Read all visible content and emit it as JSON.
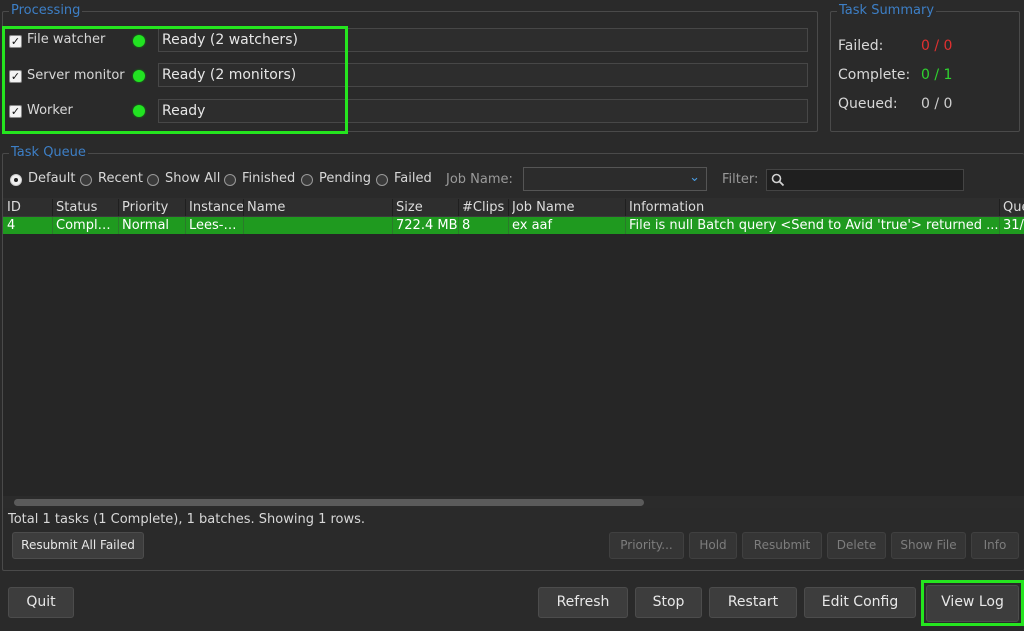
{
  "processing": {
    "legend": "Processing",
    "rows": [
      {
        "label": "File watcher",
        "status": "Ready (2 watchers)",
        "checked": true
      },
      {
        "label": "Server monitor",
        "status": "Ready (2 monitors)",
        "checked": true
      },
      {
        "label": "Worker",
        "status": "Ready",
        "checked": true
      }
    ],
    "indicator_color": "#22e322"
  },
  "summary": {
    "legend": "Task Summary",
    "failed_label": "Failed:",
    "failed_value": "0 / 0",
    "complete_label": "Complete:",
    "complete_value": "0 / 1",
    "queued_label": "Queued:",
    "queued_value": "0 / 0",
    "colors": {
      "failed": "#e03030",
      "complete": "#2fd32f",
      "queued": "#cfcfcf"
    }
  },
  "queue": {
    "legend": "Task Queue",
    "filters": [
      "Default",
      "Recent",
      "Show All",
      "Finished",
      "Pending",
      "Failed"
    ],
    "selected_filter": "Default",
    "job_name_label": "Job Name:",
    "filter_label": "Filter:",
    "columns": [
      "ID",
      "Status",
      "Priority",
      "Instance",
      "Name",
      "Size",
      "#Clips",
      "Job Name",
      "Information",
      "Que"
    ],
    "rows": [
      {
        "id": "4",
        "status": "Complete",
        "priority": "Normal",
        "instance": "Lees-…",
        "name": "",
        "size": "722.4 MB",
        "clips": "8",
        "job_name": "ex aaf",
        "information": "File is null Batch query <Send to Avid 'true'> returned ...",
        "queued": "31/"
      }
    ],
    "row_color": "#1f9a1f",
    "footer": "Total 1 tasks (1 Complete), 1 batches. Showing 1 rows.",
    "resubmit_all_failed": "Resubmit All Failed",
    "actions": [
      "Priority...",
      "Hold",
      "Resubmit",
      "Delete",
      "Show File",
      "Info"
    ]
  },
  "bottom": {
    "quit": "Quit",
    "refresh": "Refresh",
    "stop": "Stop",
    "restart": "Restart",
    "edit_config": "Edit Config",
    "view_log": "View Log"
  },
  "highlight_color": "#25e51f"
}
